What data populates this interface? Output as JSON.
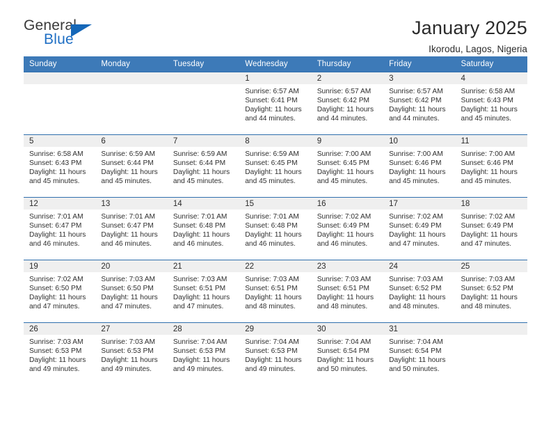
{
  "brand": {
    "word_top": "General",
    "word_bottom": "Blue",
    "triangle_icon": "triangle-icon",
    "accent_color": "#1567b8"
  },
  "header": {
    "title": "January 2025",
    "subtitle": "Ikorodu, Lagos, Nigeria"
  },
  "theme": {
    "header_blue": "#3d7ab8",
    "row_border": "#2f6fad",
    "daynum_band": "#efefef"
  },
  "calendar": {
    "weekday_headers": [
      "Sunday",
      "Monday",
      "Tuesday",
      "Wednesday",
      "Thursday",
      "Friday",
      "Saturday"
    ],
    "labels": {
      "sunrise": "Sunrise:",
      "sunset": "Sunset:",
      "daylight": "Daylight:"
    },
    "weeks": [
      [
        {
          "day": "",
          "blank": true
        },
        {
          "day": "",
          "blank": true
        },
        {
          "day": "",
          "blank": true
        },
        {
          "day": "1",
          "sunrise": "Sunrise: 6:57 AM",
          "sunset": "Sunset: 6:41 PM",
          "daylight_1": "Daylight: 11 hours",
          "daylight_2": "and 44 minutes."
        },
        {
          "day": "2",
          "sunrise": "Sunrise: 6:57 AM",
          "sunset": "Sunset: 6:42 PM",
          "daylight_1": "Daylight: 11 hours",
          "daylight_2": "and 44 minutes."
        },
        {
          "day": "3",
          "sunrise": "Sunrise: 6:57 AM",
          "sunset": "Sunset: 6:42 PM",
          "daylight_1": "Daylight: 11 hours",
          "daylight_2": "and 44 minutes."
        },
        {
          "day": "4",
          "sunrise": "Sunrise: 6:58 AM",
          "sunset": "Sunset: 6:43 PM",
          "daylight_1": "Daylight: 11 hours",
          "daylight_2": "and 45 minutes."
        }
      ],
      [
        {
          "day": "5",
          "sunrise": "Sunrise: 6:58 AM",
          "sunset": "Sunset: 6:43 PM",
          "daylight_1": "Daylight: 11 hours",
          "daylight_2": "and 45 minutes."
        },
        {
          "day": "6",
          "sunrise": "Sunrise: 6:59 AM",
          "sunset": "Sunset: 6:44 PM",
          "daylight_1": "Daylight: 11 hours",
          "daylight_2": "and 45 minutes."
        },
        {
          "day": "7",
          "sunrise": "Sunrise: 6:59 AM",
          "sunset": "Sunset: 6:44 PM",
          "daylight_1": "Daylight: 11 hours",
          "daylight_2": "and 45 minutes."
        },
        {
          "day": "8",
          "sunrise": "Sunrise: 6:59 AM",
          "sunset": "Sunset: 6:45 PM",
          "daylight_1": "Daylight: 11 hours",
          "daylight_2": "and 45 minutes."
        },
        {
          "day": "9",
          "sunrise": "Sunrise: 7:00 AM",
          "sunset": "Sunset: 6:45 PM",
          "daylight_1": "Daylight: 11 hours",
          "daylight_2": "and 45 minutes."
        },
        {
          "day": "10",
          "sunrise": "Sunrise: 7:00 AM",
          "sunset": "Sunset: 6:46 PM",
          "daylight_1": "Daylight: 11 hours",
          "daylight_2": "and 45 minutes."
        },
        {
          "day": "11",
          "sunrise": "Sunrise: 7:00 AM",
          "sunset": "Sunset: 6:46 PM",
          "daylight_1": "Daylight: 11 hours",
          "daylight_2": "and 45 minutes."
        }
      ],
      [
        {
          "day": "12",
          "sunrise": "Sunrise: 7:01 AM",
          "sunset": "Sunset: 6:47 PM",
          "daylight_1": "Daylight: 11 hours",
          "daylight_2": "and 46 minutes."
        },
        {
          "day": "13",
          "sunrise": "Sunrise: 7:01 AM",
          "sunset": "Sunset: 6:47 PM",
          "daylight_1": "Daylight: 11 hours",
          "daylight_2": "and 46 minutes."
        },
        {
          "day": "14",
          "sunrise": "Sunrise: 7:01 AM",
          "sunset": "Sunset: 6:48 PM",
          "daylight_1": "Daylight: 11 hours",
          "daylight_2": "and 46 minutes."
        },
        {
          "day": "15",
          "sunrise": "Sunrise: 7:01 AM",
          "sunset": "Sunset: 6:48 PM",
          "daylight_1": "Daylight: 11 hours",
          "daylight_2": "and 46 minutes."
        },
        {
          "day": "16",
          "sunrise": "Sunrise: 7:02 AM",
          "sunset": "Sunset: 6:49 PM",
          "daylight_1": "Daylight: 11 hours",
          "daylight_2": "and 46 minutes."
        },
        {
          "day": "17",
          "sunrise": "Sunrise: 7:02 AM",
          "sunset": "Sunset: 6:49 PM",
          "daylight_1": "Daylight: 11 hours",
          "daylight_2": "and 47 minutes."
        },
        {
          "day": "18",
          "sunrise": "Sunrise: 7:02 AM",
          "sunset": "Sunset: 6:49 PM",
          "daylight_1": "Daylight: 11 hours",
          "daylight_2": "and 47 minutes."
        }
      ],
      [
        {
          "day": "19",
          "sunrise": "Sunrise: 7:02 AM",
          "sunset": "Sunset: 6:50 PM",
          "daylight_1": "Daylight: 11 hours",
          "daylight_2": "and 47 minutes."
        },
        {
          "day": "20",
          "sunrise": "Sunrise: 7:03 AM",
          "sunset": "Sunset: 6:50 PM",
          "daylight_1": "Daylight: 11 hours",
          "daylight_2": "and 47 minutes."
        },
        {
          "day": "21",
          "sunrise": "Sunrise: 7:03 AM",
          "sunset": "Sunset: 6:51 PM",
          "daylight_1": "Daylight: 11 hours",
          "daylight_2": "and 47 minutes."
        },
        {
          "day": "22",
          "sunrise": "Sunrise: 7:03 AM",
          "sunset": "Sunset: 6:51 PM",
          "daylight_1": "Daylight: 11 hours",
          "daylight_2": "and 48 minutes."
        },
        {
          "day": "23",
          "sunrise": "Sunrise: 7:03 AM",
          "sunset": "Sunset: 6:51 PM",
          "daylight_1": "Daylight: 11 hours",
          "daylight_2": "and 48 minutes."
        },
        {
          "day": "24",
          "sunrise": "Sunrise: 7:03 AM",
          "sunset": "Sunset: 6:52 PM",
          "daylight_1": "Daylight: 11 hours",
          "daylight_2": "and 48 minutes."
        },
        {
          "day": "25",
          "sunrise": "Sunrise: 7:03 AM",
          "sunset": "Sunset: 6:52 PM",
          "daylight_1": "Daylight: 11 hours",
          "daylight_2": "and 48 minutes."
        }
      ],
      [
        {
          "day": "26",
          "sunrise": "Sunrise: 7:03 AM",
          "sunset": "Sunset: 6:53 PM",
          "daylight_1": "Daylight: 11 hours",
          "daylight_2": "and 49 minutes."
        },
        {
          "day": "27",
          "sunrise": "Sunrise: 7:03 AM",
          "sunset": "Sunset: 6:53 PM",
          "daylight_1": "Daylight: 11 hours",
          "daylight_2": "and 49 minutes."
        },
        {
          "day": "28",
          "sunrise": "Sunrise: 7:04 AM",
          "sunset": "Sunset: 6:53 PM",
          "daylight_1": "Daylight: 11 hours",
          "daylight_2": "and 49 minutes."
        },
        {
          "day": "29",
          "sunrise": "Sunrise: 7:04 AM",
          "sunset": "Sunset: 6:53 PM",
          "daylight_1": "Daylight: 11 hours",
          "daylight_2": "and 49 minutes."
        },
        {
          "day": "30",
          "sunrise": "Sunrise: 7:04 AM",
          "sunset": "Sunset: 6:54 PM",
          "daylight_1": "Daylight: 11 hours",
          "daylight_2": "and 50 minutes."
        },
        {
          "day": "31",
          "sunrise": "Sunrise: 7:04 AM",
          "sunset": "Sunset: 6:54 PM",
          "daylight_1": "Daylight: 11 hours",
          "daylight_2": "and 50 minutes."
        },
        {
          "day": "",
          "blank": true
        }
      ]
    ]
  }
}
